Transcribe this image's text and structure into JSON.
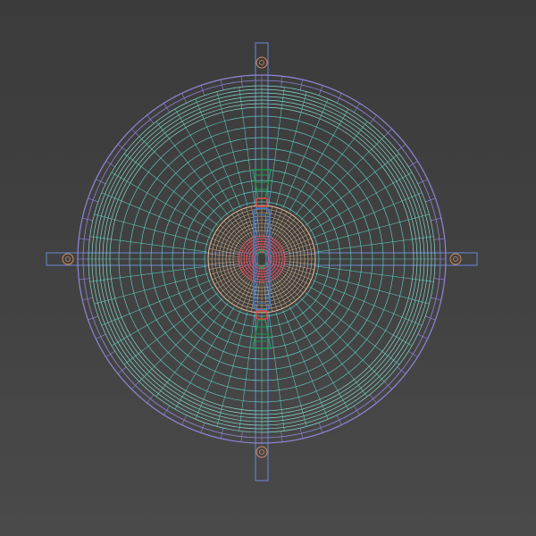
{
  "viewport": {
    "background": "#404040",
    "view": "top-orthographic-wireframe"
  },
  "colors": {
    "outer_rim": "#8f86d8",
    "bowl_mesh": "#5fd4c8",
    "bowl_mesh_light": "#8fe6dc",
    "socket_mesh": "#e8c49a",
    "socket_inner": "#e85a6a",
    "clip_green": "#1f9a4f",
    "clip_red": "#e0463c",
    "holder_blue": "#3a7fd0",
    "arm_blue": "#6a88d8",
    "screw_orange": "#d08a60"
  },
  "icons": {
    "mount_screw": "screw-head-icon",
    "bulb_clip": "spring-clip-icon"
  }
}
